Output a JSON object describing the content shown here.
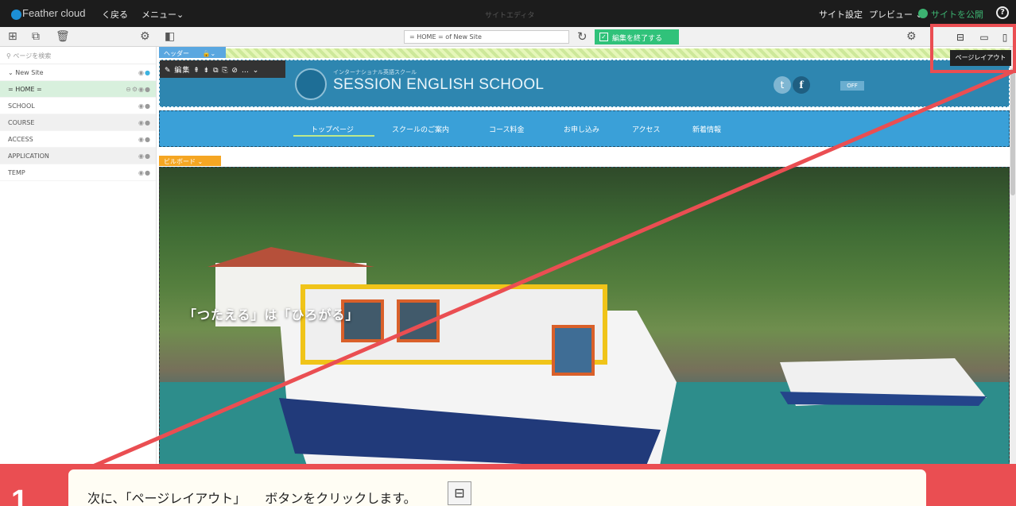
{
  "app": {
    "logo": "Feather cloud",
    "back": "く戻る",
    "menu": "メニュー⌄",
    "title": "サイトエディタ",
    "site_settings": "サイト設定",
    "preview": "プレビュー ⌄",
    "publish": "サイトを公開",
    "help": "?"
  },
  "toolbar": {
    "url": "= HOME = of New Site",
    "finish_label": "編集を終了する"
  },
  "sidebar": {
    "search_placeholder": "ページを検索",
    "root": "New Site",
    "items": [
      {
        "label": "= HOME ="
      },
      {
        "label": "SCHOOL"
      },
      {
        "label": "COURSE"
      },
      {
        "label": "ACCESS"
      },
      {
        "label": "APPLICATION"
      },
      {
        "label": "TEMP"
      }
    ]
  },
  "canvas": {
    "header_tag": "ヘッダー",
    "edit_label": "✎ 編集",
    "brand_small": "インターナショナル英語スクール",
    "brand_name": "SESSION ENGLISH SCHOOL",
    "sns_off": "OFF",
    "nav": [
      "トップページ",
      "スクールのご案内",
      "コース料金",
      "お申し込み",
      "アクセス",
      "新着情報"
    ],
    "billboard_tag": "ビルボード",
    "hero_text": "「つたえる」は「ひろがる」"
  },
  "tooltip": "ページレイアウト",
  "callout": {
    "number": "1",
    "text": "次に、「ページレイアウト」　　ボタンをクリックします。"
  },
  "colors": {
    "accent_red": "#ea4e52",
    "header_blue": "#2e86b0",
    "nav_blue": "#3aa0d8",
    "green": "#30c27a"
  }
}
